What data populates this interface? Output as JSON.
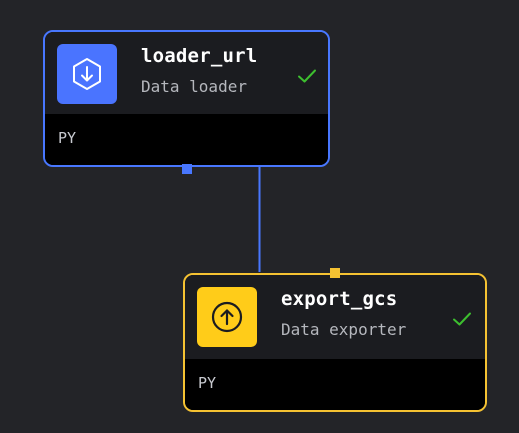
{
  "blocks": [
    {
      "name": "loader_url",
      "type": "Data loader",
      "language": "PY",
      "status": "success",
      "icon": "download-icon",
      "accent": "#4877ff",
      "icon_bg": "#4a74ff"
    },
    {
      "name": "export_gcs",
      "type": "Data exporter",
      "language": "PY",
      "status": "success",
      "icon": "upload-icon",
      "accent": "#f5c232",
      "icon_bg": "#ffcc19"
    }
  ],
  "colors": {
    "canvas_bg": "#232428",
    "edge": "#4877ff",
    "success_check": "#3dbf2f"
  }
}
